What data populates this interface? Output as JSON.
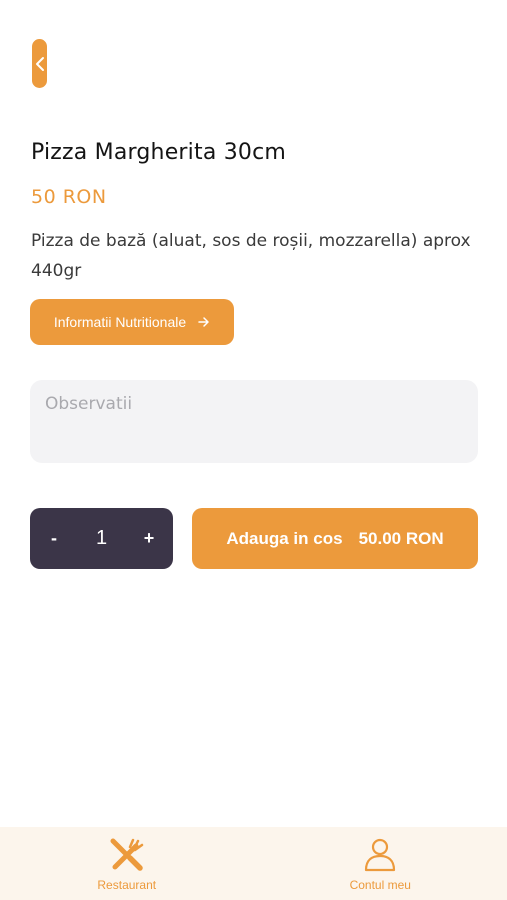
{
  "colors": {
    "accent": "#ec9a3c",
    "dark": "#3b3548",
    "input_bg": "#f3f3f5",
    "tabbar_bg": "#fcf5ec"
  },
  "header": {
    "back_icon": "chevron-left-icon"
  },
  "product": {
    "title": "Pizza Margherita 30cm",
    "price": "50 RON",
    "description": "Pizza de bază (aluat, sos de roșii, mozzarella) aprox 440gr"
  },
  "nutrition_button": {
    "label": "Informatii Nutritionale",
    "icon": "arrow-right-icon"
  },
  "notes": {
    "placeholder": "Observatii",
    "value": ""
  },
  "quantity": {
    "decrement_label": "-",
    "value": "1",
    "increment_label": "+"
  },
  "add_to_cart": {
    "label": "Adauga in cos",
    "total": "50.00 RON"
  },
  "tabbar": {
    "items": [
      {
        "label": "Restaurant",
        "icon": "fork-knife-icon"
      },
      {
        "label": "Contul meu",
        "icon": "user-icon"
      }
    ]
  }
}
